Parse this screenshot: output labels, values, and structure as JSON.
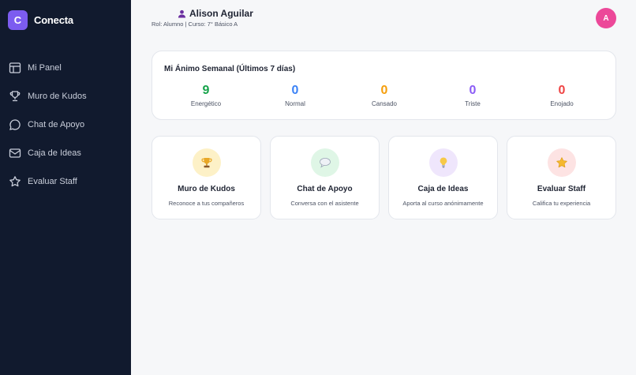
{
  "brand": {
    "logo_letter": "C",
    "name": "Conecta",
    "logo_color": "#7c5cf0"
  },
  "sidebar": {
    "items": [
      {
        "label": "Mi Panel",
        "icon": "dashboard-icon"
      },
      {
        "label": "Muro de Kudos",
        "icon": "trophy-icon"
      },
      {
        "label": "Chat de Apoyo",
        "icon": "chat-bubble-icon"
      },
      {
        "label": "Caja de Ideas",
        "icon": "mail-icon"
      },
      {
        "label": "Evaluar Staff",
        "icon": "star-icon"
      }
    ]
  },
  "header": {
    "user_name": "Alison Aguilar",
    "user_icon": "user-icon",
    "subtitle": "Rol: Alumno | Curso: 7° Básico A",
    "avatar_letter": "A",
    "avatar_color": "#ec4899"
  },
  "mood": {
    "title": "Mi Ánimo Semanal (Últimos 7 días)",
    "stats": [
      {
        "value": "9",
        "label": "Energético",
        "color": "#16a34a"
      },
      {
        "value": "0",
        "label": "Normal",
        "color": "#3b82f6"
      },
      {
        "value": "0",
        "label": "Cansado",
        "color": "#f59e0b"
      },
      {
        "value": "0",
        "label": "Triste",
        "color": "#8b5cf6"
      },
      {
        "value": "0",
        "label": "Enojado",
        "color": "#ef4444"
      }
    ]
  },
  "tiles": [
    {
      "title": "Muro de Kudos",
      "desc": "Reconoce a tus compañeros",
      "icon": "trophy-icon",
      "bg": "#fdf1c7"
    },
    {
      "title": "Chat de Apoyo",
      "desc": "Conversa con el asistente",
      "icon": "speech-bubble-icon",
      "bg": "#dff6e6"
    },
    {
      "title": "Caja de Ideas",
      "desc": "Aporta al curso anónimamente",
      "icon": "lightbulb-icon",
      "bg": "#efe6fc"
    },
    {
      "title": "Evaluar Staff",
      "desc": "Califica tu experiencia",
      "icon": "star-icon",
      "bg": "#fde3e3"
    }
  ]
}
